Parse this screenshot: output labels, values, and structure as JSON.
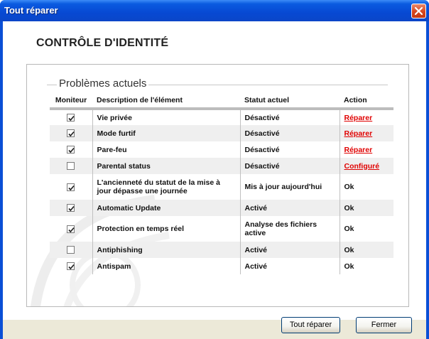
{
  "window": {
    "title": "Tout réparer"
  },
  "page": {
    "title": "CONTRÔLE D'IDENTITÉ"
  },
  "section": {
    "title": "Problèmes actuels"
  },
  "table": {
    "headers": [
      "Moniteur",
      "Description de l'élément",
      "Statut actuel",
      "Action"
    ],
    "rows": [
      {
        "checked": true,
        "description": "Vie privée",
        "status": "Désactivé",
        "action": "Réparer",
        "action_link": true
      },
      {
        "checked": true,
        "description": "Mode furtif",
        "status": "Désactivé",
        "action": "Réparer",
        "action_link": true
      },
      {
        "checked": true,
        "description": "Pare-feu",
        "status": "Désactivé",
        "action": "Réparer",
        "action_link": true
      },
      {
        "checked": false,
        "description": "Parental status",
        "status": "Désactivé",
        "action": "Configuré",
        "action_link": true
      },
      {
        "checked": true,
        "description": "L'ancienneté du statut de la mise à jour dépasse une journée",
        "status": "Mis à jour aujourd'hui",
        "action": "Ok",
        "action_link": false
      },
      {
        "checked": true,
        "description": "Automatic Update",
        "status": "Activé",
        "action": "Ok",
        "action_link": false
      },
      {
        "checked": true,
        "description": "Protection en temps réel",
        "status": "Analyse des fichiers active",
        "action": "Ok",
        "action_link": false
      },
      {
        "checked": false,
        "description": "Antiphishing",
        "status": "Activé",
        "action": "Ok",
        "action_link": false
      },
      {
        "checked": true,
        "description": "Antispam",
        "status": "Activé",
        "action": "Ok",
        "action_link": false
      }
    ]
  },
  "buttons": {
    "repair_all": "Tout réparer",
    "close": "Fermer"
  },
  "colors": {
    "titlebar": "#0a4fd6",
    "link": "#e00000",
    "close_button": "#d6451d"
  }
}
